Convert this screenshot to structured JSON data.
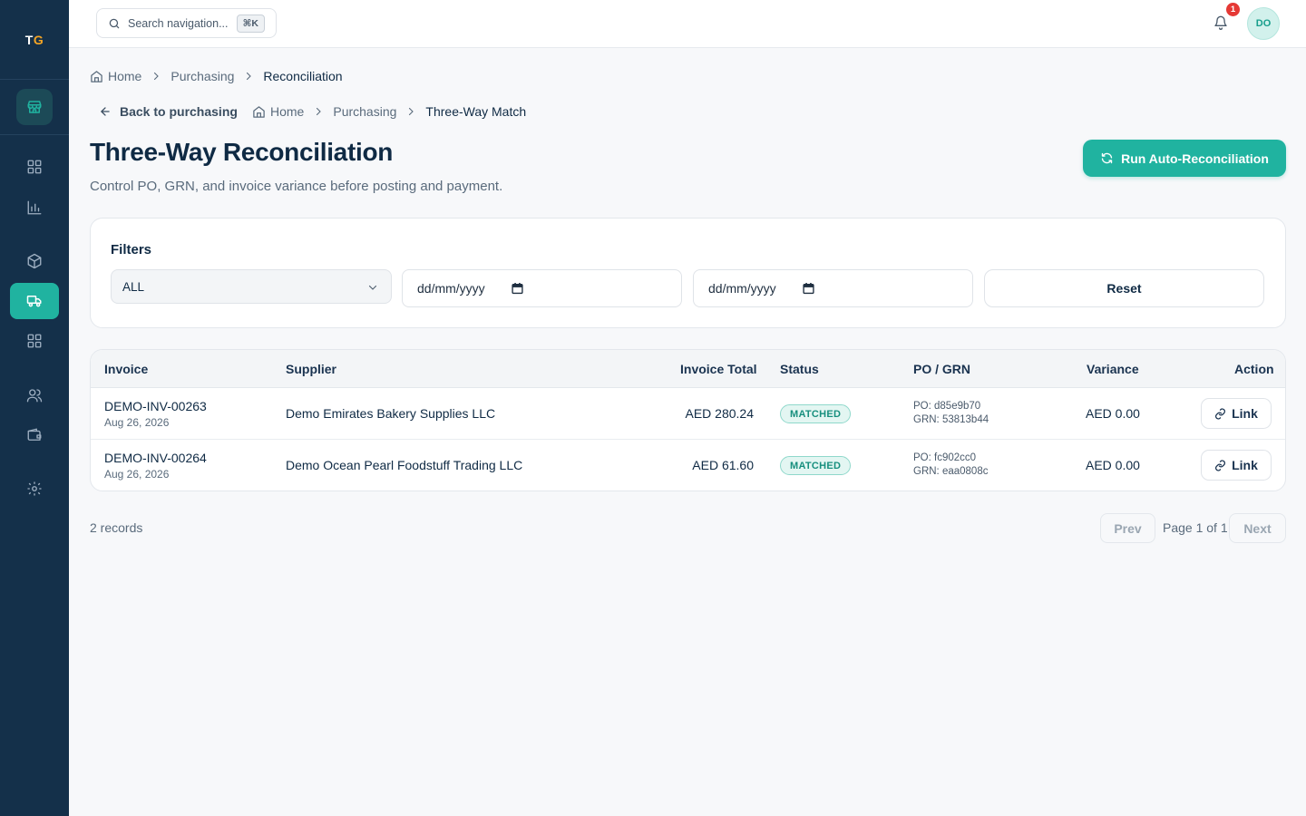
{
  "brand": {
    "t": "T",
    "g": "G"
  },
  "search": {
    "placeholder": "Search navigation...",
    "shortcut": "⌘K"
  },
  "notifications": {
    "count": "1"
  },
  "user": {
    "initials": "DO"
  },
  "breadcrumb_top": {
    "home": "Home",
    "section": "Purchasing",
    "current": "Reconciliation"
  },
  "breadcrumb_inner": {
    "back": "Back to purchasing",
    "home": "Home",
    "section": "Purchasing",
    "current": "Three-Way Match"
  },
  "header": {
    "title": "Three-Way Reconciliation",
    "subtitle": "Control PO, GRN, and invoice variance before posting and payment.",
    "run_button": "Run Auto-Reconciliation"
  },
  "filters": {
    "title": "Filters",
    "status_value": "ALL",
    "date_from_placeholder": "dd/mm/yyyy",
    "date_to_placeholder": "dd/mm/yyyy",
    "reset_label": "Reset"
  },
  "table": {
    "columns": {
      "invoice": "Invoice",
      "supplier": "Supplier",
      "total": "Invoice Total",
      "status": "Status",
      "po_grn": "PO / GRN",
      "variance": "Variance",
      "action": "Action"
    },
    "rows": [
      {
        "invoice": "DEMO-INV-00263",
        "date": "Aug 26, 2026",
        "supplier": "Demo Emirates Bakery Supplies LLC",
        "total": "AED 280.24",
        "status": "MATCHED",
        "po": "PO: d85e9b70",
        "grn": "GRN: 53813b44",
        "variance": "AED 0.00",
        "action": "Link"
      },
      {
        "invoice": "DEMO-INV-00264",
        "date": "Aug 26, 2026",
        "supplier": "Demo Ocean Pearl Foodstuff Trading LLC",
        "total": "AED 61.60",
        "status": "MATCHED",
        "po": "PO: fc902cc0",
        "grn": "GRN: eaa0808c",
        "variance": "AED 0.00",
        "action": "Link"
      }
    ]
  },
  "footer": {
    "records": "2 records",
    "prev": "Prev",
    "page": "Page 1 of 1",
    "next": "Next"
  },
  "colors": {
    "sidebar": "#14304a",
    "accent": "#20b3a0",
    "badge_bg": "#e3f6f2",
    "notification": "#e53935"
  },
  "icons": {
    "sidebar": [
      "store-icon",
      "grid-icon",
      "bar-chart-icon",
      "box-icon",
      "truck-icon",
      "apps-icon",
      "users-icon",
      "wallet-icon",
      "settings-icon"
    ],
    "topbar": [
      "search-icon",
      "bell-icon"
    ],
    "actions": [
      "refresh-icon",
      "link-icon",
      "home-icon",
      "chevron-right-icon",
      "arrow-left-icon",
      "calendar-icon",
      "chevron-down-icon"
    ]
  }
}
